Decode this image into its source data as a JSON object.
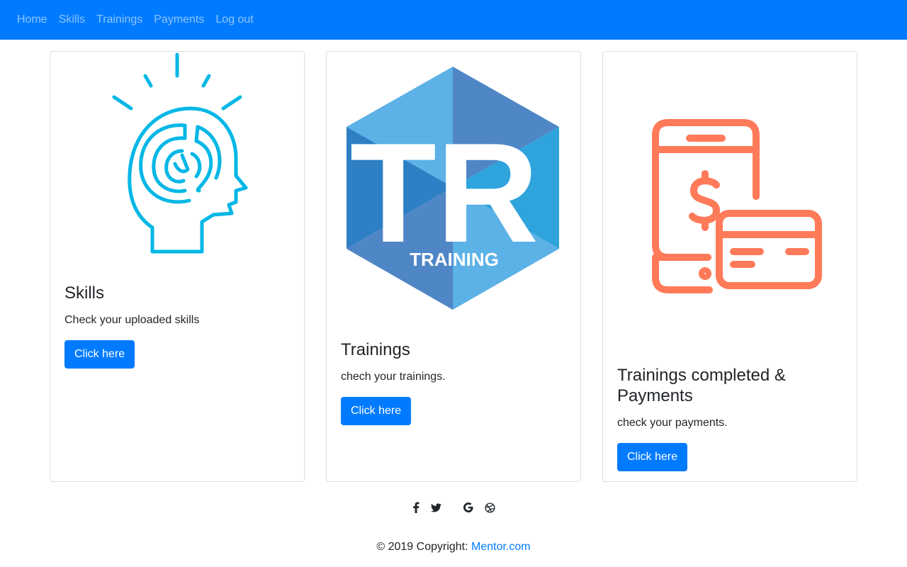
{
  "nav": {
    "items": [
      {
        "label": "Home"
      },
      {
        "label": "Skills"
      },
      {
        "label": "Trainings"
      },
      {
        "label": "Payments"
      },
      {
        "label": "Log out"
      }
    ]
  },
  "cards": [
    {
      "title": "Skills",
      "text": "Check your uploaded skills",
      "button": "Click here",
      "icon": "brain-head-icon",
      "color": "#00b7e6"
    },
    {
      "title": "Trainings",
      "text": "chech your trainings.",
      "button": "Click here",
      "icon": "training-logo",
      "logo_letters": "TR",
      "logo_caption": "TRAINING",
      "color": "#4a90d0"
    },
    {
      "title": "Trainings completed & Payments",
      "text": "check your payments.",
      "button": "Click here",
      "icon": "phone-payment-icon",
      "color": "#ff7a59"
    }
  ],
  "social": [
    "facebook-icon",
    "twitter-icon",
    "google-icon",
    "dribbble-icon"
  ],
  "footer": {
    "copyright": "© 2019 Copyright: ",
    "link": "Mentor.com"
  },
  "colors": {
    "primary": "#007bff"
  }
}
